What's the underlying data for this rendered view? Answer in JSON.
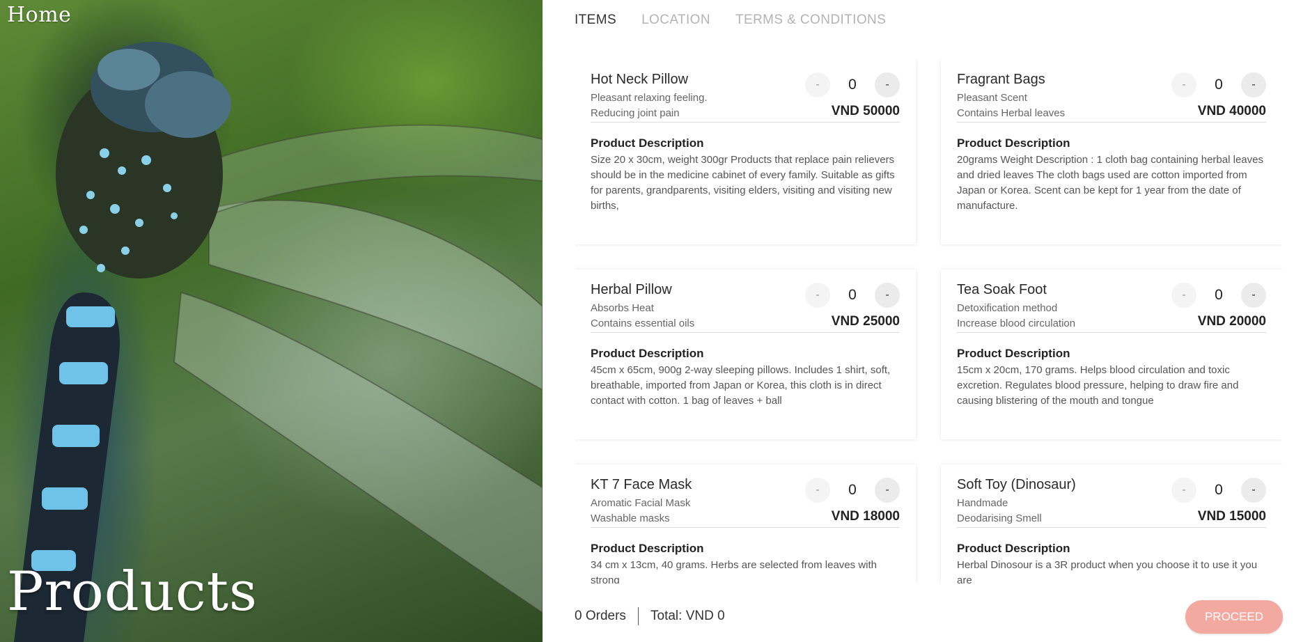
{
  "hero": {
    "home_label": "Home",
    "title": "Products"
  },
  "tabs": [
    {
      "label": "ITEMS",
      "active": true
    },
    {
      "label": "LOCATION",
      "active": false
    },
    {
      "label": "TERMS & CONDITIONS",
      "active": false
    }
  ],
  "products": [
    {
      "name": "Hot Neck Pillow",
      "line1": "Pleasant relaxing feeling.",
      "line2": "Reducing joint pain",
      "quantity": "0",
      "price": "VND 50000",
      "desc_title": "Product Description",
      "description": "Size 20 x 30cm, weight 300gr Products that replace pain relievers should be in the medicine cabinet of every family. Suitable as gifts for parents, grandparents, visiting elders, visiting and visiting new births,"
    },
    {
      "name": "Fragrant Bags",
      "line1": "Pleasant Scent",
      "line2": "Contains Herbal leaves",
      "quantity": "0",
      "price": "VND 40000",
      "desc_title": "Product Description",
      "description": "20grams Weight Description : 1 cloth bag containing herbal leaves and dried leaves The cloth bags used are cotton imported from Japan or Korea. Scent can be kept for 1 year from the date of manufacture."
    },
    {
      "name": "Herbal Pillow",
      "line1": "Absorbs Heat",
      "line2": "Contains essential oils",
      "quantity": "0",
      "price": "VND 25000",
      "desc_title": "Product Description",
      "description": "45cm x 65cm, 900g 2-way sleeping pillows. Includes 1 shirt, soft, breathable, imported from Japan or Korea, this cloth is in direct contact with cotton. 1 bag of leaves + ball"
    },
    {
      "name": "Tea Soak Foot",
      "line1": "Detoxification method",
      "line2": "Increase blood circulation",
      "quantity": "0",
      "price": "VND 20000",
      "desc_title": "Product Description",
      "description": "15cm x 20cm, 170 grams. Helps blood circulation and toxic excretion. Regulates blood pressure, helping to draw fire and causing blistering of the mouth and tongue"
    },
    {
      "name": "KT 7 Face Mask",
      "line1": "Aromatic Facial Mask",
      "line2": "Washable masks",
      "quantity": "0",
      "price": "VND 18000",
      "desc_title": "Product Description",
      "description": "34 cm x 13cm, 40 grams. Herbs are selected from leaves with strong"
    },
    {
      "name": "Soft Toy (Dinosaur)",
      "line1": "Handmade",
      "line2": "Deodarising Smell",
      "quantity": "0",
      "price": "VND 15000",
      "desc_title": "Product Description",
      "description": "Herbal Dinosour is a 3R product when you choose it to use it you are"
    }
  ],
  "qty_buttons": {
    "minus": "-",
    "plus": "-"
  },
  "footer": {
    "orders": "0 Orders",
    "total": "Total: VND 0",
    "proceed": "PROCEED"
  },
  "colors": {
    "accent": "#f4a9a0",
    "tab_inactive": "#b3b3b3"
  }
}
